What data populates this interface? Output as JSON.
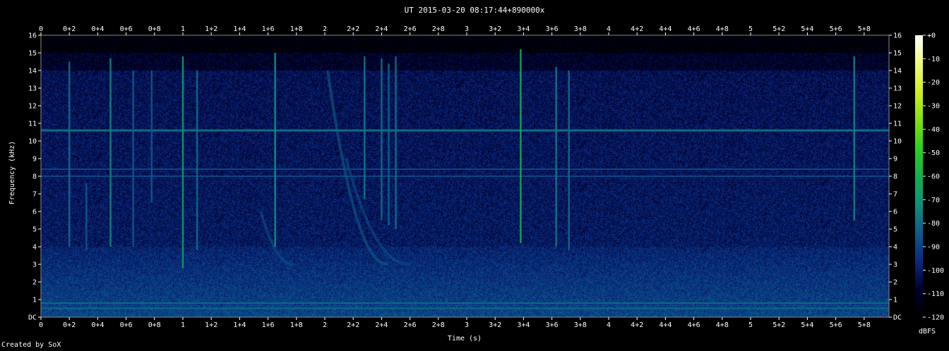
{
  "chart_data": {
    "type": "heatmap",
    "title": "UT 2015-03-20 08:17:44+890000x",
    "xlabel": "Time (s)",
    "ylabel": "Frequency (kHz)",
    "xlim": [
      0,
      5.975
    ],
    "ylim": [
      0,
      16
    ],
    "x_ticks": [
      "0",
      "0+2",
      "0+4",
      "0+6",
      "0+8",
      "1",
      "1+2",
      "1+4",
      "1+6",
      "1+8",
      "2",
      "2+2",
      "2+4",
      "2+6",
      "2+8",
      "3",
      "3+2",
      "3+4",
      "3+6",
      "3+8",
      "4",
      "4+2",
      "4+4",
      "4+6",
      "4+8",
      "5",
      "5+2",
      "5+4",
      "5+6",
      "5+8"
    ],
    "x_tick_values": [
      0,
      0.2,
      0.4,
      0.6,
      0.8,
      1,
      1.2,
      1.4,
      1.6,
      1.8,
      2,
      2.2,
      2.4,
      2.6,
      2.8,
      3,
      3.2,
      3.4,
      3.6,
      3.8,
      4,
      4.2,
      4.4,
      4.6,
      4.8,
      5,
      5.2,
      5.4,
      5.6,
      5.8
    ],
    "y_ticks": [
      "DC",
      "1",
      "2",
      "3",
      "4",
      "5",
      "6",
      "7",
      "8",
      "9",
      "10",
      "11",
      "12",
      "13",
      "14",
      "15",
      "16"
    ],
    "y_tick_values": [
      0,
      1,
      2,
      3,
      4,
      5,
      6,
      7,
      8,
      9,
      10,
      11,
      12,
      13,
      14,
      15,
      16
    ],
    "colorbar": {
      "label": "dBFS",
      "ticks": [
        "+0",
        "-10",
        "-20",
        "-30",
        "-40",
        "-50",
        "-60",
        "-70",
        "-80",
        "-90",
        "-100",
        "-110",
        "-120"
      ],
      "tick_values": [
        0,
        -10,
        -20,
        -30,
        -40,
        -50,
        -60,
        -70,
        -80,
        -90,
        -100,
        -110,
        -120
      ],
      "range": [
        -120,
        0
      ]
    },
    "features": {
      "hum_lines_khz": [
        10.6,
        8.4,
        8.0,
        0.5,
        0.8
      ],
      "impulses": [
        {
          "t": 0.2,
          "f_low": 4,
          "f_high": 14.5,
          "db": -80
        },
        {
          "t": 0.32,
          "f_low": 3.8,
          "f_high": 7.6,
          "db": -85
        },
        {
          "t": 0.49,
          "f_low": 4,
          "f_high": 14.7,
          "db": -75
        },
        {
          "t": 0.65,
          "f_low": 4,
          "f_high": 14,
          "db": -85
        },
        {
          "t": 0.78,
          "f_low": 6.5,
          "f_high": 14,
          "db": -85
        },
        {
          "t": 1.0,
          "f_low": 2.8,
          "f_high": 14.8,
          "db": -68
        },
        {
          "t": 1.1,
          "f_low": 3.8,
          "f_high": 14,
          "db": -80
        },
        {
          "t": 1.65,
          "f_low": 4,
          "f_high": 15,
          "db": -72
        },
        {
          "t": 2.28,
          "f_low": 6.7,
          "f_high": 14.8,
          "db": -78
        },
        {
          "t": 2.4,
          "f_low": 5.5,
          "f_high": 14.7,
          "db": -80
        },
        {
          "t": 2.45,
          "f_low": 5.2,
          "f_high": 14.4,
          "db": -82
        },
        {
          "t": 2.5,
          "f_low": 5.0,
          "f_high": 14.8,
          "db": -80
        },
        {
          "t": 3.38,
          "f_low": 4.2,
          "f_high": 15.2,
          "db": -62
        },
        {
          "t": 3.63,
          "f_low": 4,
          "f_high": 14.2,
          "db": -78
        },
        {
          "t": 3.72,
          "f_low": 3.8,
          "f_high": 14,
          "db": -80
        },
        {
          "t": 5.73,
          "f_low": 5.5,
          "f_high": 14.8,
          "db": -76
        }
      ],
      "sweeps": [
        {
          "t_start": 1.55,
          "t_end": 1.78,
          "f_start": 6,
          "f_end": 3,
          "db": -85
        },
        {
          "t_start": 2.02,
          "t_end": 2.45,
          "f_start": 14,
          "f_end": 3,
          "db": -82
        },
        {
          "t_start": 2.15,
          "t_end": 2.6,
          "f_start": 9,
          "f_end": 3,
          "db": -86
        }
      ]
    }
  },
  "credit": "Created by SoX"
}
